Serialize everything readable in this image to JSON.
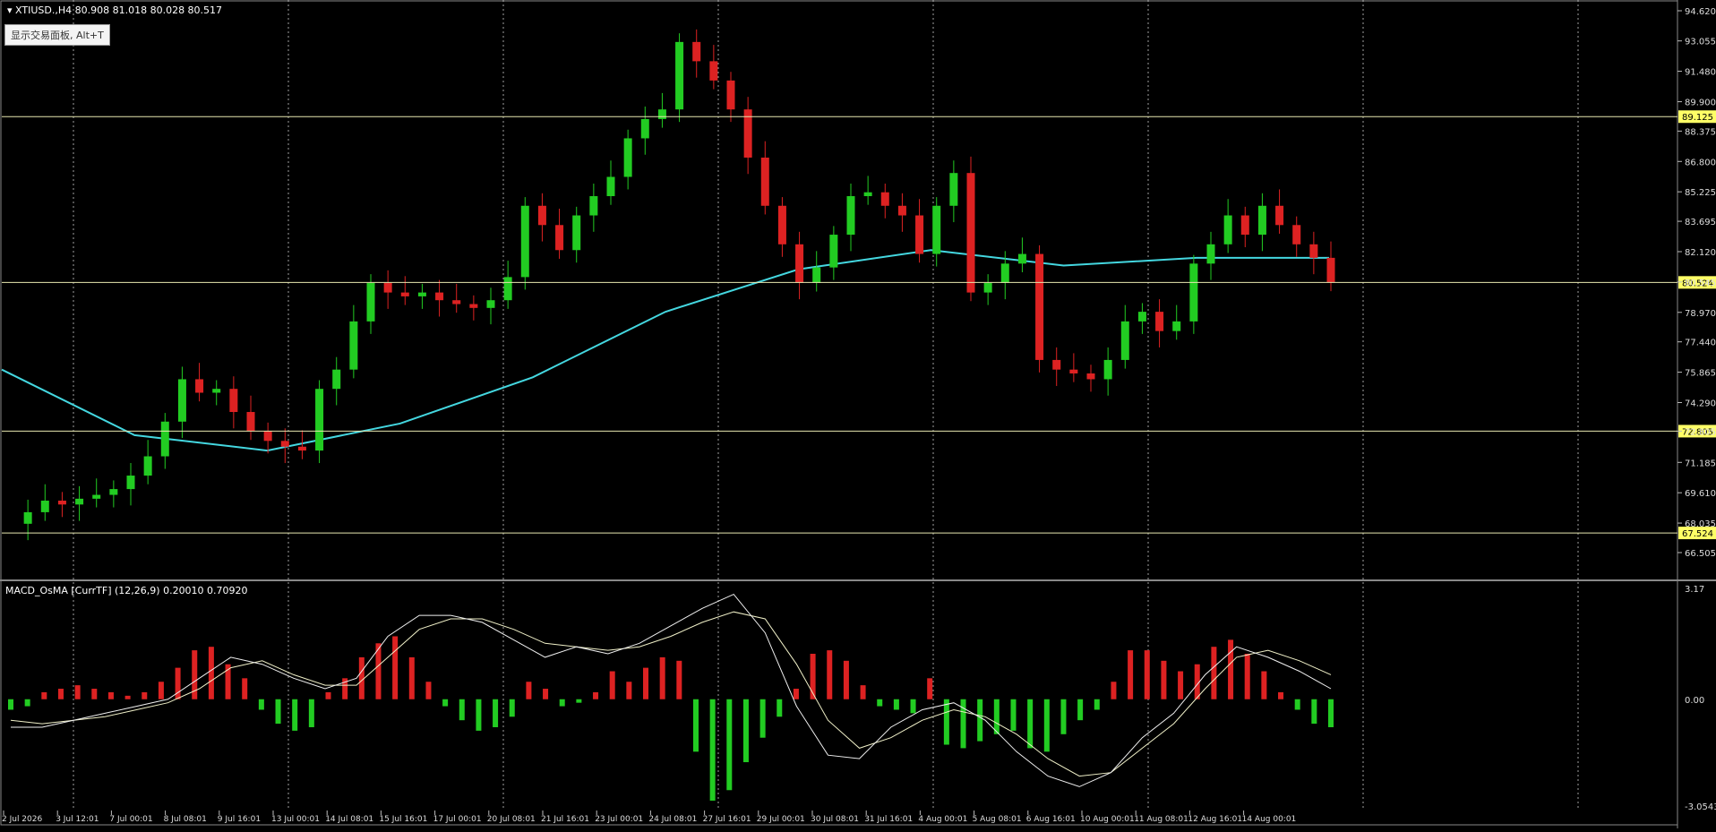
{
  "header": {
    "symbol_line": "XTIUSD.,H4  80.908 81.018 80.028 80.517",
    "trade_panel_tip": "显示交易面板, Alt+T",
    "indicator_line": "MACD_OsMA [CurrTF] (12,26,9) 0.20010 0.70920"
  },
  "colors": {
    "background": "#000000",
    "bull": "#22cc22",
    "bear": "#dd2222",
    "ma": "#44d7e0",
    "hline": "#e8e8b0",
    "label_bg": "#ffff66",
    "macd_line": "#f0f0f0",
    "signal_line": "#f0f0c8",
    "grid": "#c8c8c8"
  },
  "chart_data": [
    {
      "type": "candlestick",
      "symbol": "XTIUSD.",
      "timeframe": "H4",
      "ylim": [
        66.505,
        94.62
      ],
      "y_ticks": [
        94.62,
        93.055,
        91.48,
        89.9,
        88.375,
        86.8,
        85.225,
        83.695,
        82.12,
        80.545,
        78.97,
        77.44,
        75.865,
        74.29,
        72.805,
        71.185,
        69.61,
        68.035,
        66.505
      ],
      "x_ticks": [
        "2 Jul 2026",
        "3 Jul 12:01",
        "7 Jul 00:01",
        "8 Jul 08:01",
        "9 Jul 16:01",
        "13 Jul 00:01",
        "14 Jul 08:01",
        "15 Jul 16:01",
        "17 Jul 00:01",
        "20 Jul 08:01",
        "21 Jul 16:01",
        "23 Jul 00:01",
        "24 Jul 08:01",
        "27 Jul 16:01",
        "29 Jul 00:01",
        "30 Jul 08:01",
        "31 Jul 16:01",
        "4 Aug 00:01",
        "5 Aug 08:01",
        "6 Aug 16:01",
        "10 Aug 00:01",
        "11 Aug 08:01",
        "12 Aug 16:01",
        "14 Aug 00:01"
      ],
      "horizontal_lines": [
        {
          "value": 89.125,
          "label": "89.125"
        },
        {
          "value": 80.524,
          "label": "80.524"
        },
        {
          "value": 72.805,
          "label": "72.805"
        },
        {
          "value": 67.524,
          "label": "67.524"
        }
      ],
      "close_path": [
        68.0,
        68.6,
        69.2,
        69.0,
        69.3,
        69.5,
        69.8,
        70.5,
        71.5,
        73.3,
        75.5,
        74.8,
        75.0,
        73.8,
        72.8,
        72.3,
        72.0,
        71.8,
        75.0,
        76.0,
        78.5,
        80.5,
        80.0,
        79.8,
        80.0,
        79.6,
        79.4,
        79.2,
        79.6,
        80.8,
        84.5,
        83.5,
        82.2,
        84.0,
        85.0,
        86.0,
        88.0,
        89.0,
        89.5,
        93.0,
        92.0,
        91.0,
        89.5,
        87.0,
        84.5,
        82.5,
        80.5,
        81.3,
        83.0,
        85.0,
        85.2,
        84.5,
        84.0,
        82.0,
        84.5,
        86.2,
        80.0,
        80.5,
        81.5,
        82.0,
        76.5,
        76.0,
        75.8,
        75.5,
        76.5,
        78.5,
        79.0,
        78.0,
        78.5,
        81.5,
        82.5,
        84.0,
        83.0,
        84.5,
        83.5,
        82.5,
        81.8,
        80.517
      ],
      "moving_average": {
        "x": [
          0,
          0.1,
          0.2,
          0.3,
          0.4,
          0.5,
          0.6,
          0.7,
          0.8,
          0.9,
          1.0
        ],
        "values": [
          76.0,
          72.6,
          71.8,
          73.2,
          75.6,
          79.0,
          81.2,
          82.2,
          81.4,
          81.8,
          81.8
        ]
      }
    },
    {
      "type": "bar",
      "name": "MACD_OsMA [CurrTF] (12,26,9)",
      "ylim": [
        -3.05431,
        3.17
      ],
      "y_ticks": [
        "3.17",
        "0.00",
        "-3.05431"
      ],
      "histogram": [
        -0.3,
        -0.2,
        0.2,
        0.3,
        0.4,
        0.3,
        0.2,
        0.1,
        0.2,
        0.5,
        0.9,
        1.4,
        1.5,
        1.0,
        0.6,
        -0.3,
        -0.7,
        -0.9,
        -0.8,
        0.2,
        0.6,
        1.2,
        1.6,
        1.8,
        1.2,
        0.5,
        -0.2,
        -0.6,
        -0.9,
        -0.8,
        -0.5,
        0.5,
        0.3,
        -0.2,
        -0.1,
        0.2,
        0.8,
        0.5,
        0.9,
        1.2,
        1.1,
        -1.5,
        -2.9,
        -2.6,
        -1.8,
        -1.1,
        -0.5,
        0.3,
        1.3,
        1.4,
        1.1,
        0.4,
        -0.2,
        -0.3,
        -0.4,
        0.6,
        -1.3,
        -1.4,
        -1.2,
        -1.0,
        -0.9,
        -1.4,
        -1.5,
        -1.0,
        -0.6,
        -0.3,
        0.5,
        1.4,
        1.4,
        1.1,
        0.8,
        1.0,
        1.5,
        1.7,
        1.3,
        0.8,
        0.2,
        -0.3,
        -0.7,
        -0.8
      ],
      "macd_line": [
        -0.8,
        -0.8,
        -0.6,
        -0.4,
        -0.2,
        0.0,
        0.6,
        1.2,
        1.0,
        0.6,
        0.3,
        0.6,
        1.8,
        2.4,
        2.4,
        2.2,
        1.7,
        1.2,
        1.5,
        1.3,
        1.6,
        2.1,
        2.6,
        3.0,
        1.9,
        -0.2,
        -1.6,
        -1.7,
        -0.8,
        -0.3,
        -0.1,
        -0.6,
        -1.5,
        -2.2,
        -2.5,
        -2.1,
        -1.1,
        -0.4,
        0.7,
        1.5,
        1.2,
        0.8,
        0.3
      ],
      "signal_line": [
        -0.6,
        -0.7,
        -0.6,
        -0.5,
        -0.3,
        -0.1,
        0.3,
        0.9,
        1.1,
        0.7,
        0.4,
        0.4,
        1.2,
        2.0,
        2.3,
        2.3,
        2.0,
        1.6,
        1.5,
        1.4,
        1.5,
        1.8,
        2.2,
        2.5,
        2.3,
        1.0,
        -0.6,
        -1.4,
        -1.1,
        -0.6,
        -0.3,
        -0.5,
        -1.0,
        -1.7,
        -2.2,
        -2.1,
        -1.4,
        -0.7,
        0.3,
        1.2,
        1.4,
        1.1,
        0.7
      ]
    }
  ]
}
